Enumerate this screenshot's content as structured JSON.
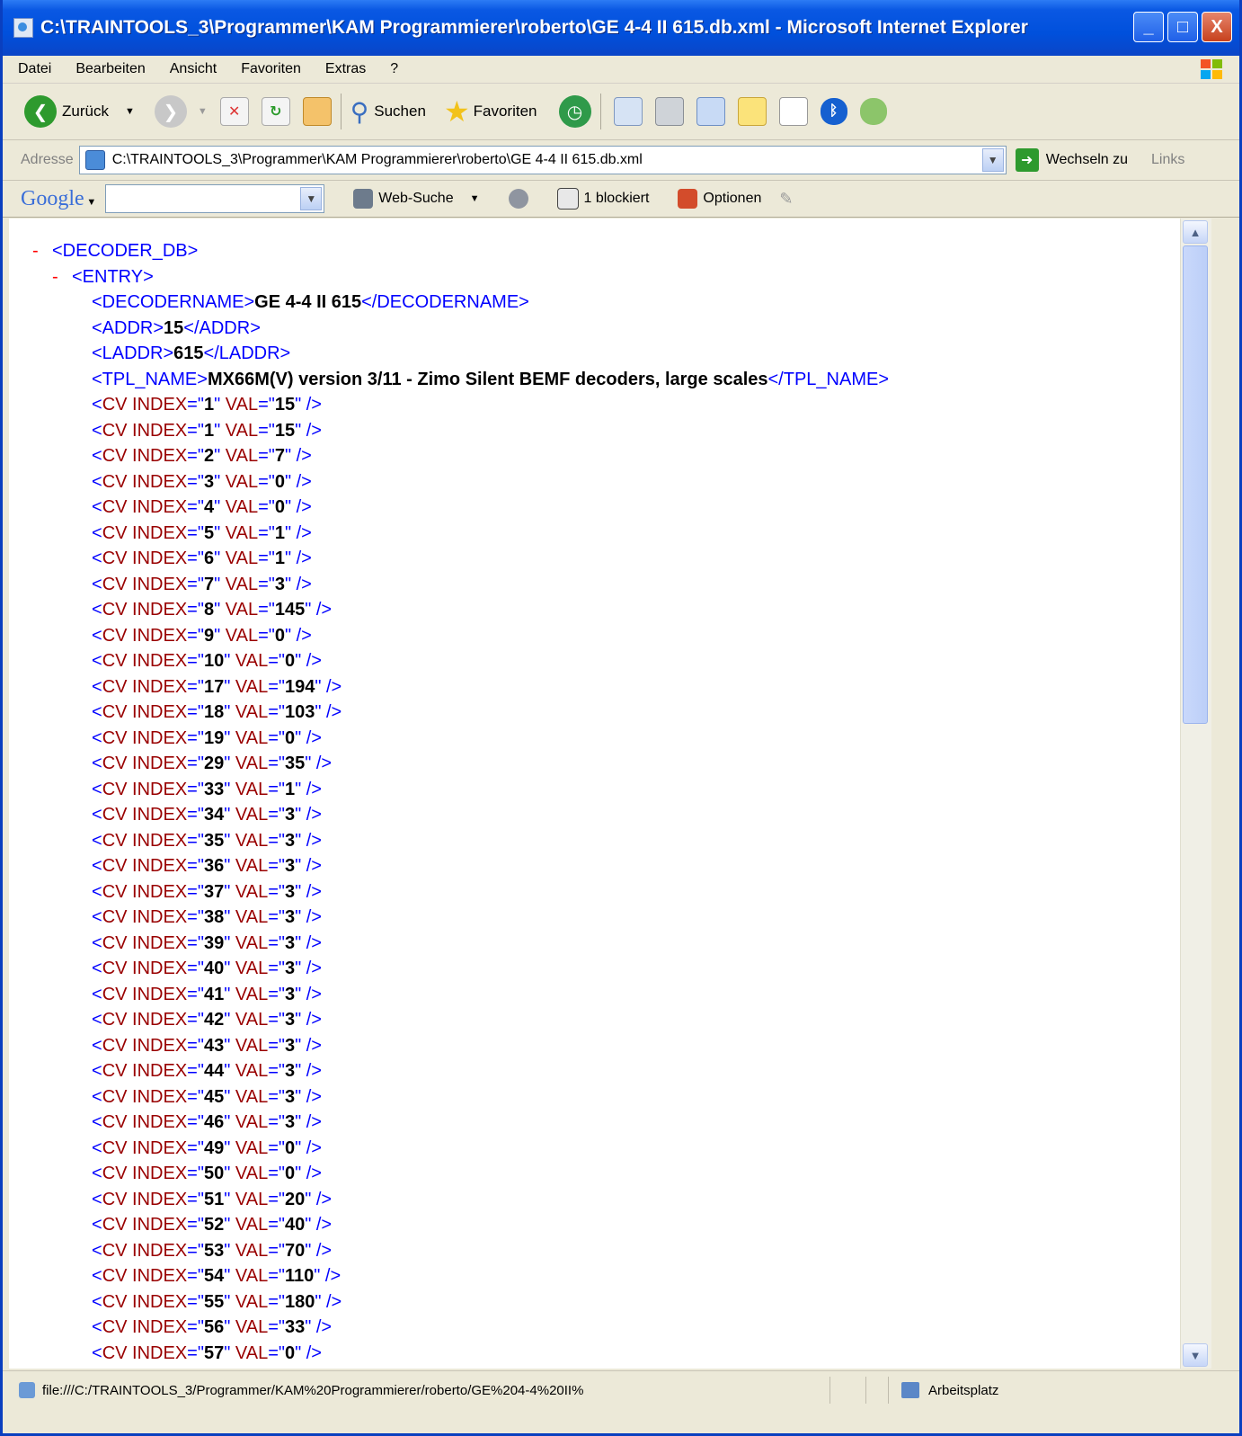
{
  "window": {
    "title": "C:\\TRAINTOOLS_3\\Programmer\\KAM Programmierer\\roberto\\GE 4-4 II 615.db.xml - Microsoft Internet Explorer",
    "min_label": "_",
    "max_label": "□",
    "close_label": "X"
  },
  "menu": [
    "Datei",
    "Bearbeiten",
    "Ansicht",
    "Favoriten",
    "Extras",
    "?"
  ],
  "toolbar": {
    "back_label": "Zurück",
    "search_label": "Suchen",
    "favorites_label": "Favoriten"
  },
  "address": {
    "label": "Adresse",
    "value": "C:\\TRAINTOOLS_3\\Programmer\\KAM Programmierer\\roberto\\GE 4-4 II 615.db.xml",
    "go_label": "Wechseln zu",
    "links_label": "Links"
  },
  "google": {
    "logo": "Google",
    "web_search": "Web-Suche",
    "blocked": "1 blockiert",
    "options": "Optionen"
  },
  "xml": {
    "root_open": "<DECODER_DB>",
    "entry_open": "<ENTRY>",
    "decodername": {
      "open": "<DECODERNAME>",
      "value": "GE 4-4 II 615",
      "close": "</DECODERNAME>"
    },
    "addr": {
      "open": "<ADDR>",
      "value": "15",
      "close": "</ADDR>"
    },
    "laddr": {
      "open": "<LADDR>",
      "value": "615",
      "close": "</LADDR>"
    },
    "tpl_name": {
      "open": "<TPL_NAME>",
      "value": "MX66M(V) version 3/11 - Zimo Silent BEMF decoders, large scales",
      "close": "</TPL_NAME>"
    },
    "cv_rows": [
      {
        "index": "1",
        "val": "15"
      },
      {
        "index": "1",
        "val": "15"
      },
      {
        "index": "2",
        "val": "7"
      },
      {
        "index": "3",
        "val": "0"
      },
      {
        "index": "4",
        "val": "0"
      },
      {
        "index": "5",
        "val": "1"
      },
      {
        "index": "6",
        "val": "1"
      },
      {
        "index": "7",
        "val": "3"
      },
      {
        "index": "8",
        "val": "145"
      },
      {
        "index": "9",
        "val": "0"
      },
      {
        "index": "10",
        "val": "0"
      },
      {
        "index": "17",
        "val": "194"
      },
      {
        "index": "18",
        "val": "103"
      },
      {
        "index": "19",
        "val": "0"
      },
      {
        "index": "29",
        "val": "35"
      },
      {
        "index": "33",
        "val": "1"
      },
      {
        "index": "34",
        "val": "3"
      },
      {
        "index": "35",
        "val": "3"
      },
      {
        "index": "36",
        "val": "3"
      },
      {
        "index": "37",
        "val": "3"
      },
      {
        "index": "38",
        "val": "3"
      },
      {
        "index": "39",
        "val": "3"
      },
      {
        "index": "40",
        "val": "3"
      },
      {
        "index": "41",
        "val": "3"
      },
      {
        "index": "42",
        "val": "3"
      },
      {
        "index": "43",
        "val": "3"
      },
      {
        "index": "44",
        "val": "3"
      },
      {
        "index": "45",
        "val": "3"
      },
      {
        "index": "46",
        "val": "3"
      },
      {
        "index": "49",
        "val": "0"
      },
      {
        "index": "50",
        "val": "0"
      },
      {
        "index": "51",
        "val": "20"
      },
      {
        "index": "52",
        "val": "40"
      },
      {
        "index": "53",
        "val": "70"
      },
      {
        "index": "54",
        "val": "110"
      },
      {
        "index": "55",
        "val": "180"
      },
      {
        "index": "56",
        "val": "33"
      },
      {
        "index": "57",
        "val": "0"
      }
    ]
  },
  "status": {
    "url": "file:///C:/TRAINTOOLS_3/Programmer/KAM%20Programmierer/roberto/GE%204-4%20II%",
    "zone": "Arbeitsplatz"
  }
}
